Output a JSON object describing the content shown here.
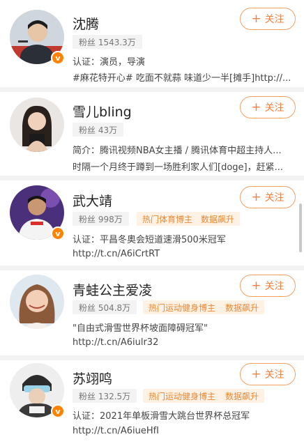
{
  "follow_label": "关注",
  "follow_plus": "+",
  "verified_mark": "v",
  "users": [
    {
      "name": "沈腾",
      "fans": "粉丝 1543.3万",
      "tags": [],
      "line1": "认证：演员，导演",
      "line2": "#麻花特开心# 吃面不就蒜 味道少一半[摊手]http://..."
    },
    {
      "name": "雪儿bling",
      "fans": "粉丝 43万",
      "tags": [],
      "line1": "简介：腾讯视频NBA女主播 / 腾讯体育中超主持人...",
      "line2": "时隔一个月终于蹲到一场胜利家人们[doge]，赶紧..."
    },
    {
      "name": "武大靖",
      "fans": "粉丝 998万",
      "tags": [
        "热门体育博主",
        "数据飙升"
      ],
      "line1": "认证：平昌冬奥会短道速滑500米冠军",
      "line2": "http://t.cn/A6iCrtRT"
    },
    {
      "name": "青蛙公主爱凌",
      "fans": "粉丝 504.8万",
      "tags": [
        "热门运动健身博主",
        "数据飙升"
      ],
      "line1": "\"自由式滑雪世界杯坡面障碍冠军\"",
      "line2": "http://t.cn/A6iulr32"
    },
    {
      "name": "苏翊鸣",
      "fans": "粉丝 132.5万",
      "tags": [
        "热门运动健身博主",
        "数据飙升"
      ],
      "line1": "认证：2021年单板滑雪大跳台世界杯总冠军",
      "line2": "http://t.cn/A6iueHfI"
    }
  ]
}
